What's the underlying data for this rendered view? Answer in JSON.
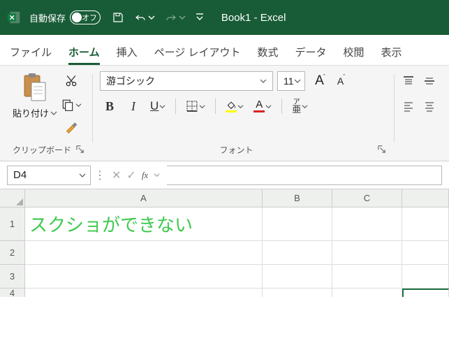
{
  "titlebar": {
    "autosave_label": "自動保存",
    "autosave_state": "オフ",
    "doc_title": "Book1  -  Excel"
  },
  "tabs": {
    "file": "ファイル",
    "home": "ホーム",
    "insert": "挿入",
    "page_layout": "ページ レイアウト",
    "formulas": "数式",
    "data": "データ",
    "review": "校閲",
    "view": "表示"
  },
  "ribbon": {
    "clipboard": {
      "paste_label": "貼り付け",
      "group_label": "クリップボード"
    },
    "font": {
      "font_name": "游ゴシック",
      "font_size": "11",
      "group_label": "フォント",
      "bold": "B",
      "italic": "I",
      "underline": "U",
      "grow": "A",
      "shrink": "A",
      "ruby_top": "ア",
      "ruby_bottom": "亜",
      "fontcolor_letter": "A",
      "highlight_color": "#ffff00",
      "fontcolor_bar": "#d22"
    }
  },
  "formula_bar": {
    "namebox": "D4",
    "fx": "fx",
    "value": ""
  },
  "grid": {
    "cols": {
      "A": "A",
      "B": "B",
      "C": "C"
    },
    "rows": {
      "1": "1",
      "2": "2",
      "3": "3",
      "4": "4"
    },
    "cells": {
      "A1": "スクショができない"
    }
  }
}
